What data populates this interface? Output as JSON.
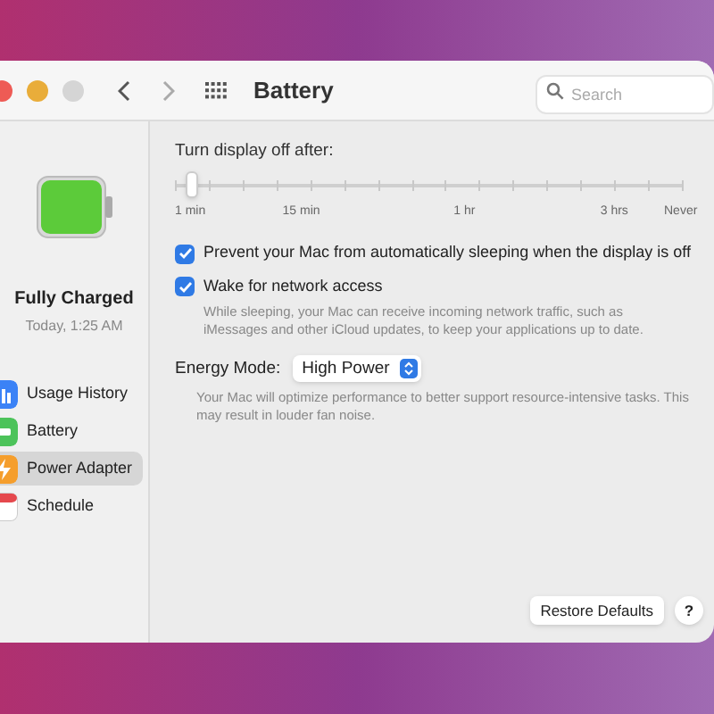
{
  "window": {
    "title": "Battery"
  },
  "search": {
    "placeholder": "Search"
  },
  "sidebar": {
    "status": "Fully Charged",
    "time": "Today, 1:25 AM",
    "level": 1,
    "items": [
      {
        "label": "Usage History",
        "kind": "chart",
        "selected": false
      },
      {
        "label": "Battery",
        "kind": "battery",
        "selected": false
      },
      {
        "label": "Power Adapter",
        "kind": "bolt",
        "selected": true
      },
      {
        "label": "Schedule",
        "kind": "calendar",
        "selected": false
      }
    ]
  },
  "display_off": {
    "label": "Turn display off after:",
    "level": 0.03,
    "ticks": [
      "1 min",
      "15 min",
      "1 hr",
      "3 hrs",
      "Never"
    ]
  },
  "options": [
    {
      "label": "Prevent your Mac from automatically sleeping when the display is off",
      "checked": true
    },
    {
      "label": "Wake for network access",
      "checked": true,
      "description": "While sleeping, your Mac can receive incoming network traffic, such as iMessages and other iCloud updates, to keep your applications up to date."
    }
  ],
  "energy_mode": {
    "label": "Energy Mode:",
    "value": "High Power",
    "description": "Your Mac will optimize performance to better support resource-intensive tasks. This may result in louder fan noise."
  },
  "buttons": [
    {
      "label": "Restore Defaults"
    },
    {
      "label": "?"
    }
  ]
}
